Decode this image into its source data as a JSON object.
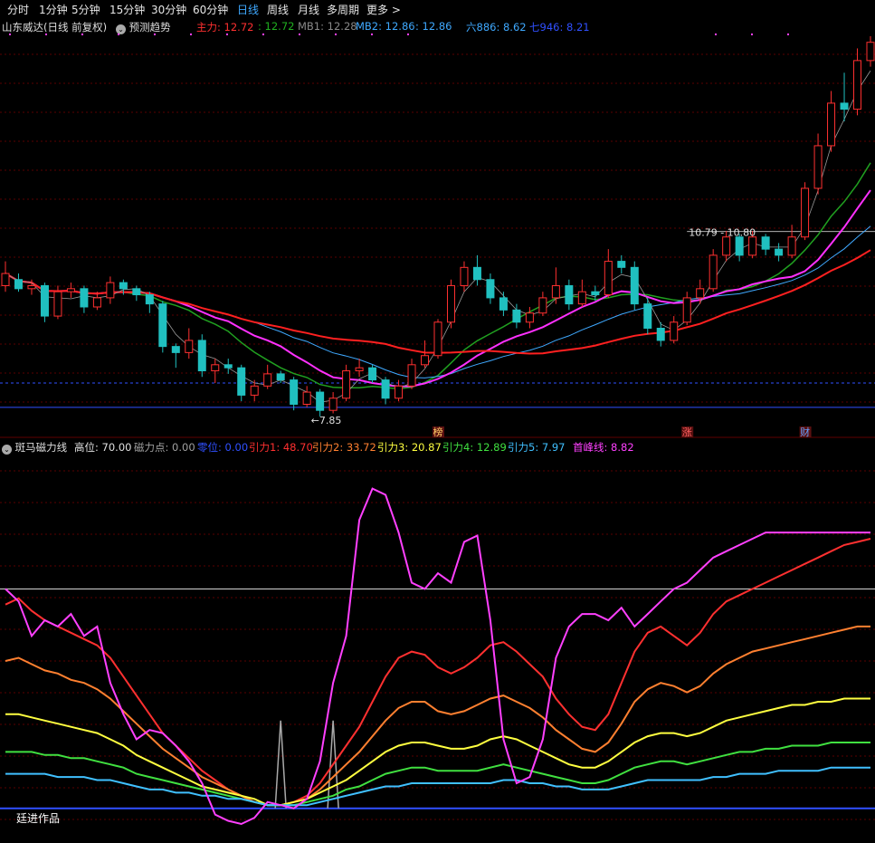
{
  "toolbar": {
    "items": [
      "分时",
      "1分钟",
      "5分钟",
      "15分钟",
      "30分钟",
      "60分钟",
      "日线",
      "周线",
      "月线",
      "多周期",
      "更多 >"
    ],
    "active_index": 6
  },
  "main_header": {
    "title": "山东威达(日线 前复权)",
    "predict_label": "预测趋势",
    "indicators": [
      {
        "text": "主力: 12.72",
        "color": "#ff3030"
      },
      {
        "text": ": 12.72",
        "color": "#20b020"
      },
      {
        "text": "MB1: 12.28",
        "color": "#888888"
      },
      {
        "text": "MB2: 12.86",
        "color": "#3fa9ff"
      },
      {
        "text": ": 12.86",
        "color": "#3fa9ff"
      },
      {
        "text": "六886: 8.62",
        "color": "#3fa9ff"
      },
      {
        "text": "七946: 8.21",
        "color": "#3050ff"
      }
    ]
  },
  "sub_header": {
    "title": "斑马磁力线",
    "indicators": [
      {
        "text": "高位: 70.00",
        "color": "#e0e0e0"
      },
      {
        "text": "磁力点: 0.00",
        "color": "#a0a0a0"
      },
      {
        "text": "零位: 0.00",
        "color": "#3050ff"
      },
      {
        "text": "引力1: 48.70",
        "color": "#ff3030"
      },
      {
        "text": "引力2: 33.72",
        "color": "#ff8030"
      },
      {
        "text": "引力3: 20.87",
        "color": "#ffff40"
      },
      {
        "text": "引力4: 12.89",
        "color": "#40e040"
      },
      {
        "text": "引力5: 7.97",
        "color": "#40c0ff"
      },
      {
        "text": "首峰线: 8.82",
        "color": "#ff40ff"
      }
    ]
  },
  "annotations": {
    "low_label": "←7.85",
    "range_label": "10.79 - 10.80",
    "markers": [
      {
        "text": "榜",
        "color": "#ffcc66",
        "index": 33
      },
      {
        "text": "涨",
        "color": "#ff6060",
        "index": 52
      },
      {
        "text": "财",
        "color": "#60a0ff",
        "index": 61
      }
    ]
  },
  "watermark": "廷进作品",
  "colors": {
    "up": "#ff3030",
    "down": "#20c0c0",
    "ma_green": "#20a020",
    "ma_blue": "#3fa9ff",
    "ma_magenta": "#ff30ff",
    "ma_red": "#ff2020"
  },
  "chart_data": [
    {
      "type": "candlestick",
      "title": "山东威达(日线 前复权)",
      "ylim": [
        7.6,
        14.0
      ],
      "candles": [
        [
          9.9,
          10.1,
          10.3,
          9.8
        ],
        [
          10.0,
          9.85,
          10.1,
          9.8
        ],
        [
          9.85,
          9.9,
          10.0,
          9.75
        ],
        [
          9.9,
          9.4,
          9.95,
          9.3
        ],
        [
          9.4,
          9.8,
          9.9,
          9.35
        ],
        [
          9.8,
          9.85,
          9.95,
          9.7
        ],
        [
          9.85,
          9.55,
          9.9,
          9.45
        ],
        [
          9.55,
          9.7,
          9.8,
          9.5
        ],
        [
          9.7,
          9.95,
          10.05,
          9.6
        ],
        [
          9.95,
          9.85,
          10.0,
          9.75
        ],
        [
          9.85,
          9.75,
          9.9,
          9.65
        ],
        [
          9.75,
          9.6,
          9.8,
          9.45
        ],
        [
          9.6,
          8.9,
          9.65,
          8.8
        ],
        [
          8.9,
          8.8,
          8.95,
          8.55
        ],
        [
          8.8,
          9.0,
          9.2,
          8.7
        ],
        [
          9.0,
          8.5,
          9.1,
          8.4
        ],
        [
          8.5,
          8.6,
          8.7,
          8.3
        ],
        [
          8.6,
          8.55,
          8.7,
          8.45
        ],
        [
          8.55,
          8.1,
          8.6,
          8.0
        ],
        [
          8.1,
          8.25,
          8.35,
          8.0
        ],
        [
          8.25,
          8.45,
          8.6,
          8.2
        ],
        [
          8.45,
          8.35,
          8.5,
          8.3
        ],
        [
          8.35,
          7.95,
          8.4,
          7.85
        ],
        [
          7.95,
          8.15,
          8.25,
          7.9
        ],
        [
          8.15,
          7.85,
          8.2,
          7.75
        ],
        [
          7.85,
          8.05,
          8.15,
          7.8
        ],
        [
          8.05,
          8.5,
          8.6,
          8.0
        ],
        [
          8.5,
          8.55,
          8.7,
          8.4
        ],
        [
          8.55,
          8.35,
          8.6,
          8.3
        ],
        [
          8.35,
          8.05,
          8.4,
          7.95
        ],
        [
          8.05,
          8.25,
          8.35,
          8.0
        ],
        [
          8.25,
          8.6,
          8.7,
          8.2
        ],
        [
          8.6,
          8.75,
          9.0,
          8.55
        ],
        [
          8.75,
          9.3,
          9.35,
          8.7
        ],
        [
          9.3,
          9.9,
          10.0,
          9.2
        ],
        [
          9.9,
          10.2,
          10.3,
          9.8
        ],
        [
          10.2,
          10.0,
          10.4,
          9.9
        ],
        [
          10.0,
          9.7,
          10.1,
          9.6
        ],
        [
          9.7,
          9.5,
          9.8,
          9.4
        ],
        [
          9.5,
          9.3,
          9.6,
          9.2
        ],
        [
          9.3,
          9.45,
          9.55,
          9.2
        ],
        [
          9.45,
          9.7,
          9.8,
          9.4
        ],
        [
          9.7,
          9.9,
          10.2,
          9.6
        ],
        [
          9.9,
          9.6,
          10.0,
          9.5
        ],
        [
          9.6,
          9.8,
          10.0,
          9.55
        ],
        [
          9.8,
          9.75,
          9.9,
          9.65
        ],
        [
          9.75,
          10.3,
          10.5,
          9.7
        ],
        [
          10.3,
          10.2,
          10.4,
          10.1
        ],
        [
          10.2,
          9.6,
          10.3,
          9.5
        ],
        [
          9.6,
          9.2,
          9.7,
          9.1
        ],
        [
          9.2,
          9.0,
          9.3,
          8.9
        ],
        [
          9.0,
          9.3,
          9.4,
          8.95
        ],
        [
          9.3,
          9.7,
          9.8,
          9.25
        ],
        [
          9.7,
          9.85,
          10.0,
          9.6
        ],
        [
          9.85,
          10.4,
          10.5,
          9.8
        ],
        [
          10.4,
          10.7,
          10.8,
          10.3
        ],
        [
          10.7,
          10.4,
          10.75,
          10.3
        ],
        [
          10.4,
          10.7,
          10.8,
          10.35
        ],
        [
          10.7,
          10.5,
          10.75,
          10.4
        ],
        [
          10.5,
          10.4,
          10.6,
          10.3
        ],
        [
          10.4,
          10.7,
          10.9,
          10.35
        ],
        [
          10.7,
          11.5,
          11.6,
          10.65
        ],
        [
          11.5,
          12.2,
          12.4,
          11.4
        ],
        [
          12.2,
          12.9,
          13.1,
          12.1
        ],
        [
          12.9,
          12.8,
          13.4,
          12.6
        ],
        [
          12.8,
          13.6,
          13.8,
          12.7
        ],
        [
          13.6,
          13.9,
          14.0,
          13.5
        ]
      ],
      "x_count": 67
    },
    {
      "type": "line",
      "title": "斑马磁力线",
      "ylim": [
        -5,
        112
      ],
      "reference_lines": [
        {
          "name": "高位",
          "value": 70
        },
        {
          "name": "零位",
          "value": 0
        }
      ],
      "series": [
        {
          "name": "引力1",
          "color": "#ff3030",
          "values": [
            65,
            67,
            63,
            60,
            58,
            56,
            54,
            52,
            48,
            42,
            36,
            30,
            24,
            20,
            16,
            12,
            9,
            6,
            4,
            2,
            1,
            1,
            2,
            4,
            8,
            14,
            20,
            26,
            34,
            42,
            48,
            50,
            49,
            45,
            43,
            45,
            48,
            52,
            53,
            50,
            46,
            42,
            35,
            30,
            26,
            25,
            30,
            40,
            50,
            56,
            58,
            55,
            52,
            56,
            62,
            66,
            68,
            70,
            72,
            74,
            76,
            78,
            80,
            82,
            84,
            85,
            86
          ]
        },
        {
          "name": "引力2",
          "color": "#ff8030",
          "values": [
            47,
            48,
            46,
            44,
            43,
            41,
            40,
            38,
            35,
            31,
            27,
            23,
            19,
            16,
            13,
            10,
            8,
            6,
            4,
            2,
            1,
            1,
            2,
            3,
            6,
            10,
            14,
            18,
            23,
            28,
            32,
            34,
            34,
            31,
            30,
            31,
            33,
            35,
            36,
            34,
            32,
            29,
            25,
            22,
            19,
            18,
            21,
            27,
            34,
            38,
            40,
            39,
            37,
            39,
            43,
            46,
            48,
            50,
            51,
            52,
            53,
            54,
            55,
            56,
            57,
            58,
            58
          ]
        },
        {
          "name": "引力3",
          "color": "#ffff40",
          "values": [
            30,
            30,
            29,
            28,
            27,
            26,
            25,
            24,
            22,
            20,
            17,
            15,
            13,
            11,
            9,
            7,
            6,
            5,
            4,
            3,
            1,
            1,
            2,
            3,
            5,
            7,
            9,
            12,
            15,
            18,
            20,
            21,
            21,
            20,
            19,
            19,
            20,
            22,
            23,
            22,
            20,
            18,
            16,
            14,
            13,
            13,
            15,
            18,
            21,
            23,
            24,
            24,
            23,
            24,
            26,
            28,
            29,
            30,
            31,
            32,
            33,
            33,
            34,
            34,
            35,
            35,
            35
          ]
        },
        {
          "name": "引力4",
          "color": "#40e040",
          "values": [
            18,
            18,
            18,
            17,
            17,
            16,
            16,
            15,
            14,
            13,
            11,
            10,
            9,
            8,
            7,
            6,
            5,
            4,
            3,
            2,
            1,
            1,
            1,
            2,
            3,
            4,
            6,
            7,
            9,
            11,
            12,
            13,
            13,
            12,
            12,
            12,
            12,
            13,
            14,
            13,
            12,
            11,
            10,
            9,
            8,
            8,
            9,
            11,
            13,
            14,
            15,
            15,
            14,
            15,
            16,
            17,
            18,
            18,
            19,
            19,
            20,
            20,
            20,
            21,
            21,
            21,
            21
          ]
        },
        {
          "name": "引力5",
          "color": "#40c0ff",
          "values": [
            11,
            11,
            11,
            11,
            10,
            10,
            10,
            9,
            9,
            8,
            7,
            6,
            6,
            5,
            5,
            4,
            4,
            3,
            3,
            2,
            1,
            1,
            1,
            1,
            2,
            3,
            4,
            5,
            6,
            7,
            7,
            8,
            8,
            8,
            8,
            8,
            8,
            8,
            9,
            9,
            8,
            8,
            7,
            7,
            6,
            6,
            6,
            7,
            8,
            9,
            9,
            9,
            9,
            9,
            10,
            10,
            11,
            11,
            11,
            12,
            12,
            12,
            12,
            13,
            13,
            13,
            13
          ]
        },
        {
          "name": "首峰线",
          "color": "#ff40ff",
          "values": [
            70,
            66,
            55,
            60,
            58,
            62,
            55,
            58,
            40,
            30,
            22,
            25,
            24,
            20,
            15,
            8,
            -2,
            -4,
            -5,
            -3,
            2,
            1,
            0,
            3,
            15,
            40,
            55,
            92,
            102,
            100,
            88,
            72,
            70,
            75,
            72,
            85,
            87,
            60,
            22,
            8,
            10,
            22,
            48,
            58,
            62,
            62,
            60,
            64,
            58,
            62,
            66,
            70,
            72,
            76,
            80,
            82,
            84,
            86,
            88,
            88,
            88,
            88,
            88,
            88,
            88,
            88,
            88
          ]
        }
      ],
      "spike_series": {
        "name": "磁力点",
        "color": "#aaaaaa",
        "indices": [
          21,
          25
        ],
        "value": 28
      }
    }
  ]
}
